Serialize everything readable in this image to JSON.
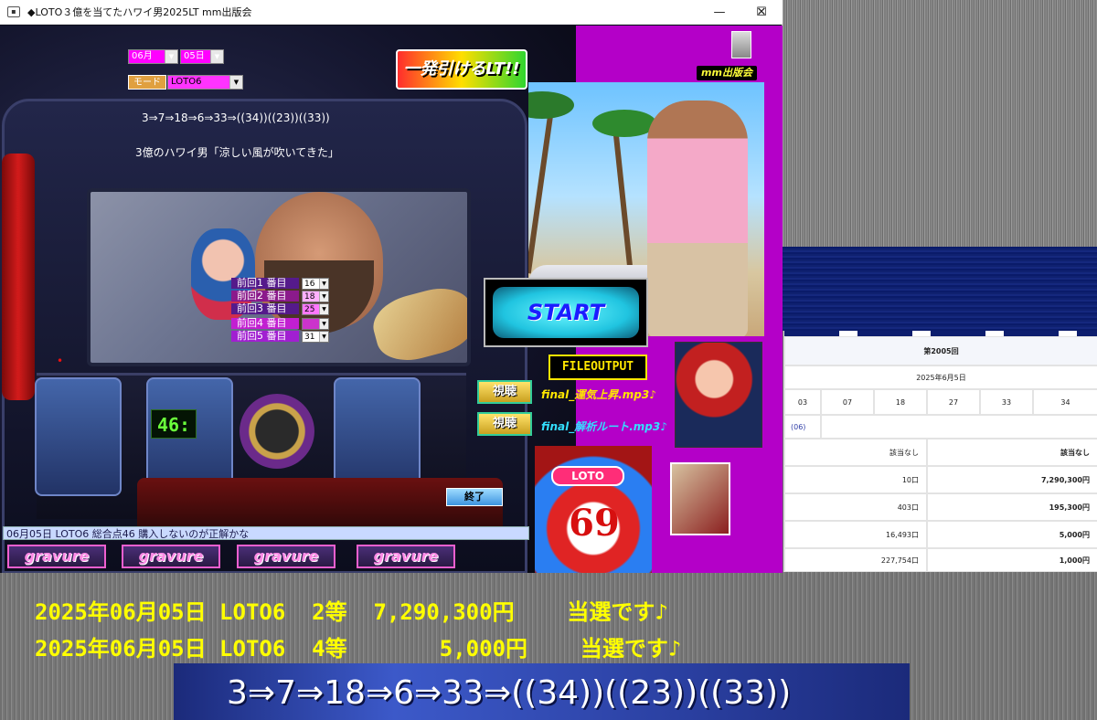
{
  "window": {
    "title": "◆LOTO３億を当てたハワイ男2025LT  mm出版会",
    "minimize": "—",
    "maximize": "☐",
    "close": "✕"
  },
  "controls": {
    "month": "06月",
    "day": "05日",
    "mode_label": "モード",
    "mode_value": "LOTO6"
  },
  "sequence": "3⇒7⇒18⇒6⇒33⇒((34))((23))((33))",
  "message": "3億のハワイ男「涼しい風が吹いてきた」",
  "logo_text": "一発引けるLT!!",
  "publisher_logo": "mm出版会",
  "previous": [
    {
      "label": "前回1 番目",
      "value": "16"
    },
    {
      "label": "前回2 番目",
      "value": "18"
    },
    {
      "label": "前回3 番目",
      "value": "25"
    },
    {
      "label": "前回4 番目",
      "value": ""
    },
    {
      "label": "前回5 番目",
      "value": "31"
    }
  ],
  "start_label": "START",
  "file_output": "FILEOUTPUT",
  "play_label": "視聴",
  "mp3": [
    "final_運気上昇.mp3♪",
    "final_解析ルート.mp3♪"
  ],
  "end_label": "終了",
  "reel_display": "46:",
  "loto_tag": "LOTO",
  "loto_number": "69",
  "status_text": "06月05日 LOTO6   総合点46   購入しないのが正解かな",
  "gravure": [
    "gravure",
    "gravure",
    "gravure",
    "gravure"
  ],
  "results_page": {
    "round": "第2005回",
    "date": "2025年6月5日",
    "numbers": [
      "03",
      "07",
      "18",
      "27",
      "33",
      "34"
    ],
    "bonus": "(06)",
    "rows": [
      {
        "count": "該当なし",
        "prize": "該当なし"
      },
      {
        "count": "10口",
        "prize": "7,290,300円"
      },
      {
        "count": "403口",
        "prize": "195,300円"
      },
      {
        "count": "16,493口",
        "prize": "5,000円"
      },
      {
        "count": "227,754口",
        "prize": "1,000円"
      }
    ]
  },
  "banner": {
    "line1": "2025年06月05日 LOTO6  2等  7,290,300円    当選です♪",
    "line2": "2025年06月05日 LOTO6  4等       5,000円    当選です♪"
  },
  "bottom_sequence": "3⇒7⇒18⇒6⇒33⇒((34))((23))((33))",
  "colors": {
    "magenta_panel": "#b400c8",
    "banner_text": "#ffff00",
    "sequence_band": "#2a3fa0"
  }
}
